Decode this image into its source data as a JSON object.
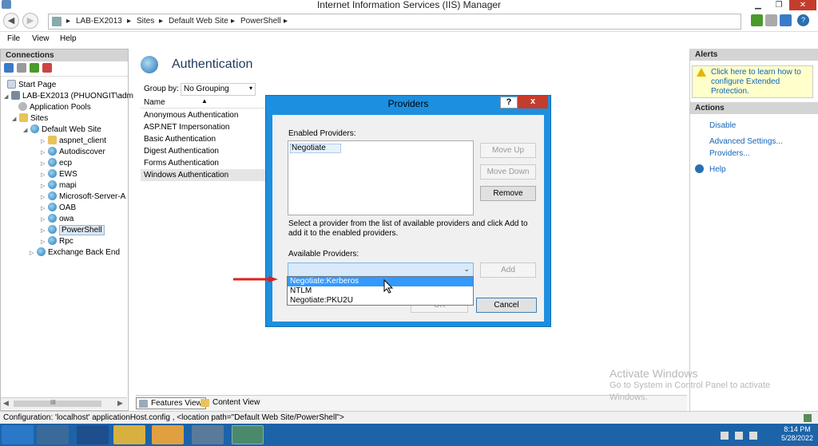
{
  "window": {
    "title": "Internet Information Services (IIS) Manager"
  },
  "address": {
    "crumbs": [
      "LAB-EX2013",
      "Sites",
      "Default Web Site",
      "PowerShell"
    ],
    "separator": "▸"
  },
  "menu": {
    "file": "File",
    "view": "View",
    "help": "Help"
  },
  "connections": {
    "header": "Connections",
    "tree": [
      {
        "label": "Start Page",
        "icon": "page-icon"
      },
      {
        "label": "LAB-EX2013 (PHUONGIT\\adm",
        "icon": "server-icon"
      },
      {
        "label": "Application Pools",
        "icon": "gear-icon"
      },
      {
        "label": "Sites",
        "icon": "folder-icon"
      },
      {
        "label": "Default Web Site",
        "icon": "globe-icon"
      },
      {
        "label": "aspnet_client",
        "icon": "folder-icon"
      },
      {
        "label": "Autodiscover",
        "icon": "globe-icon"
      },
      {
        "label": "ecp",
        "icon": "globe-icon"
      },
      {
        "label": "EWS",
        "icon": "globe-icon"
      },
      {
        "label": "mapi",
        "icon": "globe-icon"
      },
      {
        "label": "Microsoft-Server-A",
        "icon": "globe-icon"
      },
      {
        "label": "OAB",
        "icon": "globe-icon"
      },
      {
        "label": "owa",
        "icon": "globe-icon"
      },
      {
        "label": "PowerShell",
        "icon": "globe-icon"
      },
      {
        "label": "Rpc",
        "icon": "globe-icon"
      },
      {
        "label": "Exchange Back End",
        "icon": "globe-icon"
      }
    ],
    "scroll_glyph": "III"
  },
  "auth": {
    "title": "Authentication",
    "group_by_label": "Group by:",
    "group_by_value": "No Grouping",
    "column_name": "Name",
    "items": [
      "Anonymous Authentication",
      "ASP.NET Impersonation",
      "Basic Authentication",
      "Digest Authentication",
      "Forms Authentication",
      "Windows Authentication"
    ]
  },
  "tabs": {
    "features": "Features View",
    "content": "Content View"
  },
  "alerts": {
    "header": "Alerts",
    "text": "Click here to learn how to configure Extended Protection."
  },
  "actions": {
    "header": "Actions",
    "disable": "Disable",
    "advanced": "Advanced Settings...",
    "providers": "Providers...",
    "help": "Help"
  },
  "dialog": {
    "title": "Providers",
    "help_btn": "?",
    "close_btn": "x",
    "enabled_label": "Enabled Providers:",
    "enabled_items": [
      "Negotiate"
    ],
    "move_up": "Move Up",
    "move_down": "Move Down",
    "remove": "Remove",
    "description": "Select a provider from the list of available providers and click Add to add it to the enabled providers.",
    "available_label": "Available Providers:",
    "add": "Add",
    "dropdown_items": [
      "Negotiate:Kerberos",
      "NTLM",
      "Negotiate:PKU2U"
    ],
    "ok": "OK",
    "cancel": "Cancel"
  },
  "statusbar": {
    "text": "Configuration: 'localhost' applicationHost.config , <location path=\"Default Web Site/PowerShell\">"
  },
  "watermark": {
    "title": "Activate Windows",
    "line1": "Go to System in Control Panel to activate",
    "line2": "Windows."
  },
  "clock": {
    "time": "8:14 PM",
    "date": "5/28/2022"
  }
}
